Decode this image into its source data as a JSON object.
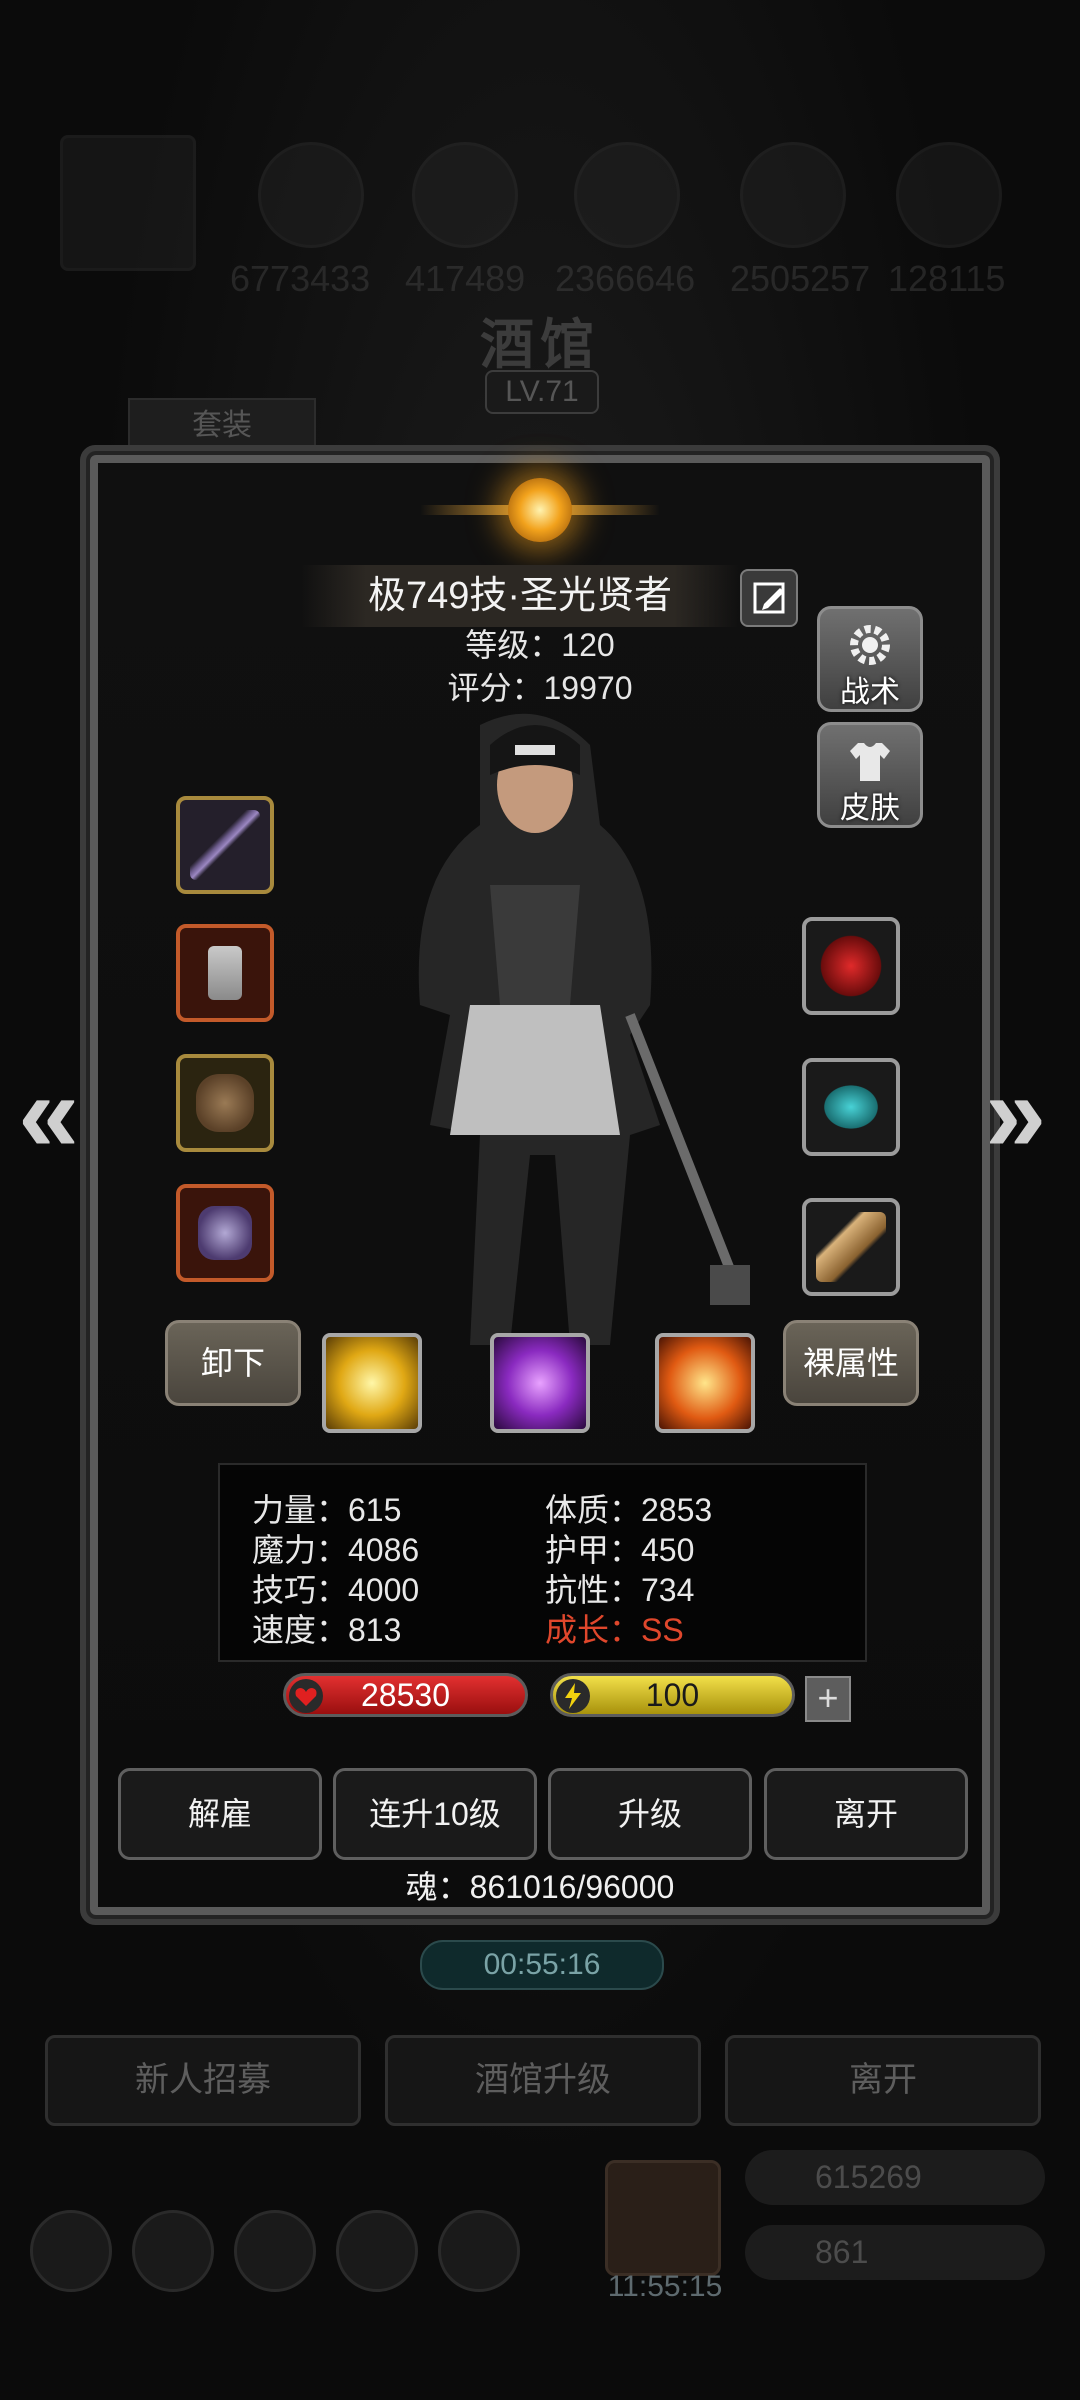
{
  "background": {
    "resources": [
      "6773433",
      "417489",
      "2366646",
      "2505257",
      "128115"
    ],
    "title": "酒馆",
    "level": "LV.71",
    "set_tab": "套装",
    "timer": "00:55:16",
    "buttons": [
      "新人招募",
      "酒馆升级",
      "离开"
    ],
    "gold": "615269",
    "gems": "861",
    "gift_timer": "11:55:15"
  },
  "hero": {
    "name": "极749技·圣光贤者",
    "level_text": "等级：120",
    "score_text": "评分：19970"
  },
  "side_buttons": {
    "tactics": "战术",
    "skin": "皮肤"
  },
  "actions": {
    "unequip": "卸下",
    "base_attr": "裸属性"
  },
  "stats": {
    "strength": "力量：615",
    "magic": "魔力：4086",
    "skill": "技巧：4000",
    "speed": "速度：813",
    "constitution": "体质：2853",
    "armor": "护甲：450",
    "resist": "抗性：734",
    "growth": "成长：SS"
  },
  "hp": "28530",
  "energy": "100",
  "bottom_buttons": {
    "dismiss": "解雇",
    "level10": "连升10级",
    "upgrade": "升级",
    "leave": "离开"
  },
  "soul": "魂：861016/96000",
  "colors": {
    "hp": "#c91515",
    "energy": "#d9c323",
    "growth": "#e0472c"
  }
}
